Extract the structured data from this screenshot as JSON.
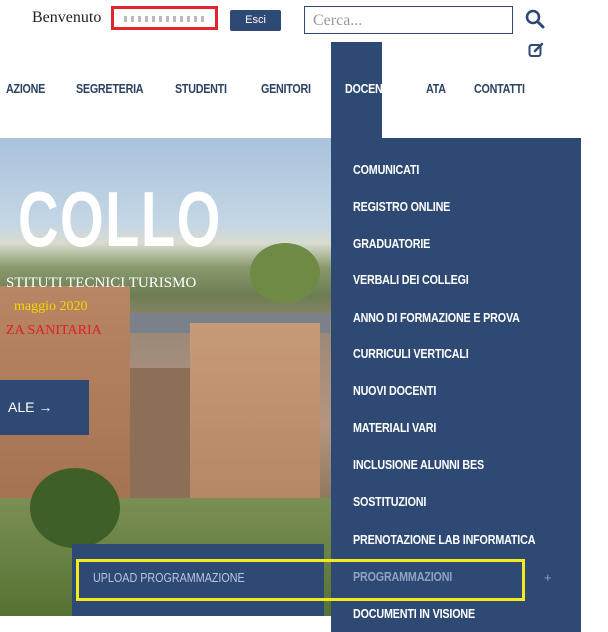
{
  "header": {
    "welcome": "Benvenuto",
    "logout_label": "Esci",
    "search_placeholder": "Cerca..."
  },
  "nav": {
    "items": [
      "AZIONE",
      "SEGRETERIA",
      "STUDENTI",
      "GENITORI",
      "DOCENTI",
      "ATA",
      "CONTATTI"
    ],
    "active": "DOCENTI"
  },
  "hero": {
    "title": "COLLO",
    "subtitle": "STITUTI TECNICI TURISMO",
    "date": "maggio 2020",
    "notice": "ZA SANITARIA",
    "button_label": "ALE →"
  },
  "docenti_menu": {
    "items": [
      "COMUNICATI",
      "REGISTRO ONLINE",
      "GRADUATORIE",
      "VERBALI DEI COLLEGI",
      "ANNO DI FORMAZIONE E PROVA",
      "CURRICULI VERTICALI",
      "NUOVI DOCENTI",
      "MATERIALI VARI",
      "INCLUSIONE ALUNNI BES",
      "SOSTITUZIONI",
      "PRENOTAZIONE LAB INFORMATICA",
      "PROGRAMMAZIONI",
      "DOCUMENTI IN VISIONE"
    ],
    "expand_symbol": "+"
  },
  "submenu": {
    "item": "UPLOAD PROGRAMMAZIONE"
  },
  "colors": {
    "navy": "#2e4a74",
    "highlight_red": "#e3262c",
    "highlight_yellow": "#f2ea1c"
  }
}
